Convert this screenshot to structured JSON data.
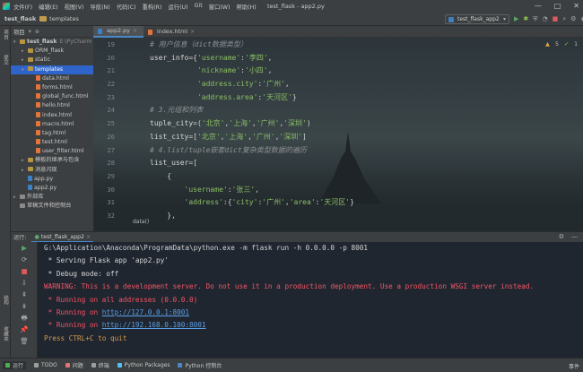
{
  "window": {
    "title": "test_flask - app2.py",
    "menu": [
      "文件(F)",
      "编辑(E)",
      "视图(V)",
      "导航(N)",
      "代码(C)",
      "重构(R)",
      "运行(U)",
      "Git",
      "窗口(W)",
      "帮助(H)"
    ],
    "controls": [
      "—",
      "□",
      "✕"
    ]
  },
  "navbar": {
    "project": "test_flask",
    "folder": "templates",
    "run_config": "test_flask_app2"
  },
  "left_stripe": [
    "项目",
    "提交",
    "结构",
    "收藏夹"
  ],
  "project_panel": {
    "title": "项目",
    "rows": [
      {
        "text": "test_flask",
        "hint": "E:\\PyCharm",
        "level": 0,
        "caret": "▾",
        "icon": "fold",
        "bold": true
      },
      {
        "text": "ORM_flask",
        "level": 1,
        "caret": "▸",
        "icon": "fold"
      },
      {
        "text": "static",
        "level": 1,
        "caret": "▸",
        "icon": "fold"
      },
      {
        "text": "templates",
        "level": 1,
        "caret": "▾",
        "icon": "fold",
        "selected": true
      },
      {
        "text": "data.html",
        "level": 2,
        "caret": "",
        "icon": "htm"
      },
      {
        "text": "forms.html",
        "level": 2,
        "caret": "",
        "icon": "htm"
      },
      {
        "text": "global_func.html",
        "level": 2,
        "caret": "",
        "icon": "htm"
      },
      {
        "text": "hello.html",
        "level": 2,
        "caret": "",
        "icon": "htm"
      },
      {
        "text": "index.html",
        "level": 2,
        "caret": "",
        "icon": "htm"
      },
      {
        "text": "macro.html",
        "level": 2,
        "caret": "",
        "icon": "htm"
      },
      {
        "text": "tag.html",
        "level": 2,
        "caret": "",
        "icon": "htm"
      },
      {
        "text": "test.html",
        "level": 2,
        "caret": "",
        "icon": "htm"
      },
      {
        "text": "user_filter.html",
        "level": 2,
        "caret": "",
        "icon": "htm"
      },
      {
        "text": "模板的继承与包含",
        "level": 1,
        "caret": "▸",
        "icon": "fold"
      },
      {
        "text": "消息闪现",
        "level": 1,
        "caret": "▸",
        "icon": "fold"
      },
      {
        "text": "app.py",
        "level": 1,
        "caret": "",
        "icon": "pyf"
      },
      {
        "text": "app2.py",
        "level": 1,
        "caret": "",
        "icon": "pyf"
      },
      {
        "text": "外部库",
        "level": 0,
        "caret": "▸",
        "icon": "lib"
      },
      {
        "text": "草稿文件和控制台",
        "level": 0,
        "caret": "",
        "icon": "lib"
      }
    ]
  },
  "editor": {
    "tabs": [
      {
        "label": "app2.py",
        "active": true
      },
      {
        "label": "index.html",
        "active": false
      }
    ],
    "warnings": "5",
    "weak": "1",
    "line_numbers": [
      "19",
      "20",
      "21",
      "22",
      "23",
      "24",
      "25",
      "26",
      "27",
      "28",
      "29",
      "30",
      "31",
      "32"
    ],
    "lines": [
      [
        {
          "t": "# 用户信息（dict数据类型）",
          "c": "c-c"
        }
      ],
      [
        {
          "t": "user_info",
          "c": "c-v"
        },
        {
          "t": "={",
          "c": "c-p"
        },
        {
          "t": "'username'",
          "c": "c-s"
        },
        {
          "t": ":",
          "c": "c-p"
        },
        {
          "t": "'李四'",
          "c": "c-s"
        },
        {
          "t": ",",
          "c": "c-p"
        }
      ],
      [
        {
          "t": "           ",
          "c": "c-p"
        },
        {
          "t": "'nickname'",
          "c": "c-s"
        },
        {
          "t": ":",
          "c": "c-p"
        },
        {
          "t": "'小四'",
          "c": "c-s"
        },
        {
          "t": ",",
          "c": "c-p"
        }
      ],
      [
        {
          "t": "           ",
          "c": "c-p"
        },
        {
          "t": "'address.city'",
          "c": "c-s"
        },
        {
          "t": ":",
          "c": "c-p"
        },
        {
          "t": "'广州'",
          "c": "c-s"
        },
        {
          "t": ",",
          "c": "c-p"
        }
      ],
      [
        {
          "t": "           ",
          "c": "c-p"
        },
        {
          "t": "'address.area'",
          "c": "c-s"
        },
        {
          "t": ":",
          "c": "c-p"
        },
        {
          "t": "'天河区'",
          "c": "c-s"
        },
        {
          "t": "}",
          "c": "c-p"
        }
      ],
      [
        {
          "t": "# 3.元组和列表",
          "c": "c-c"
        }
      ],
      [
        {
          "t": "tuple_city",
          "c": "c-v"
        },
        {
          "t": "=(",
          "c": "c-p"
        },
        {
          "t": "'北京'",
          "c": "c-s"
        },
        {
          "t": ",",
          "c": "c-p"
        },
        {
          "t": "'上海'",
          "c": "c-s"
        },
        {
          "t": ",",
          "c": "c-p"
        },
        {
          "t": "'广州'",
          "c": "c-s"
        },
        {
          "t": ",",
          "c": "c-p"
        },
        {
          "t": "'深圳'",
          "c": "c-s"
        },
        {
          "t": ")",
          "c": "c-p"
        }
      ],
      [
        {
          "t": "list_city",
          "c": "c-v"
        },
        {
          "t": "=[",
          "c": "c-p"
        },
        {
          "t": "'北京'",
          "c": "c-s"
        },
        {
          "t": ",",
          "c": "c-p"
        },
        {
          "t": "'上海'",
          "c": "c-s"
        },
        {
          "t": ",",
          "c": "c-p"
        },
        {
          "t": "'广州'",
          "c": "c-s"
        },
        {
          "t": ",",
          "c": "c-p"
        },
        {
          "t": "'深圳'",
          "c": "c-s"
        },
        {
          "t": "]",
          "c": "c-p"
        }
      ],
      [
        {
          "t": "# 4.list/tuple嵌套dict复杂类型数据的遍历",
          "c": "c-c"
        }
      ],
      [
        {
          "t": "list_user",
          "c": "c-v"
        },
        {
          "t": "=[",
          "c": "c-p"
        }
      ],
      [
        {
          "t": "    {",
          "c": "c-p"
        }
      ],
      [
        {
          "t": "        ",
          "c": "c-p"
        },
        {
          "t": "'username'",
          "c": "c-s"
        },
        {
          "t": ":",
          "c": "c-p"
        },
        {
          "t": "'张三'",
          "c": "c-s"
        },
        {
          "t": ",",
          "c": "c-p"
        }
      ],
      [
        {
          "t": "        ",
          "c": "c-p"
        },
        {
          "t": "'address'",
          "c": "c-s"
        },
        {
          "t": ":{",
          "c": "c-p"
        },
        {
          "t": "'city'",
          "c": "c-s"
        },
        {
          "t": ":",
          "c": "c-p"
        },
        {
          "t": "'广州'",
          "c": "c-s"
        },
        {
          "t": ",",
          "c": "c-p"
        },
        {
          "t": "'area'",
          "c": "c-s"
        },
        {
          "t": ":",
          "c": "c-p"
        },
        {
          "t": "'天河区'",
          "c": "c-s"
        },
        {
          "t": "}",
          "c": "c-p"
        }
      ],
      [
        {
          "t": "    },",
          "c": "c-p"
        }
      ]
    ],
    "breadcrumb": "data()"
  },
  "run_panel": {
    "label": "运行:",
    "tab": "test_flask_app2",
    "toolbar_icons": [
      "▶",
      "⟳",
      "■",
      "⇩",
      "⇞",
      "⇟",
      "🖶",
      "📌",
      "🗑"
    ],
    "console": [
      {
        "parts": [
          {
            "t": "G:\\Application\\Anaconda\\ProgramData\\python.exe -m flask run -h 0.0.0.0 -p 8001",
            "c": "o-n"
          }
        ]
      },
      {
        "parts": [
          {
            "t": " * Serving Flask app 'app2.py'",
            "c": "o-n"
          }
        ]
      },
      {
        "parts": [
          {
            "t": " * Debug mode: off",
            "c": "o-n"
          }
        ]
      },
      {
        "parts": [
          {
            "t": "WARNING: This is a development server. Do not use it in a production deployment. Use a production WSGI server instead.",
            "c": "o-r"
          }
        ]
      },
      {
        "parts": [
          {
            "t": " * Running on all addresses (0.0.0.0)",
            "c": "o-r"
          }
        ]
      },
      {
        "parts": [
          {
            "t": " * Running on ",
            "c": "o-r"
          },
          {
            "t": "http://127.0.0.1:8001",
            "c": "o-l"
          }
        ]
      },
      {
        "parts": [
          {
            "t": " * Running on ",
            "c": "o-r"
          },
          {
            "t": "http://192.168.0.100:8001",
            "c": "o-l"
          }
        ]
      },
      {
        "parts": [
          {
            "t": "Press CTRL+C to quit",
            "c": "o-y"
          }
        ]
      }
    ]
  },
  "bottom_bar": {
    "items": [
      {
        "label": "运行",
        "color": "#4caf50",
        "active": true
      },
      {
        "label": "TODO",
        "color": "#9e9e9e",
        "active": false
      },
      {
        "label": "问题",
        "color": "#e57373",
        "active": false
      },
      {
        "label": "终端",
        "color": "#9e9e9e",
        "active": false
      },
      {
        "label": "Python Packages",
        "color": "#4fc3f7",
        "active": false
      },
      {
        "label": "Python 控制台",
        "color": "#4a88c7",
        "active": false
      }
    ],
    "events": "事件"
  },
  "colors": {
    "accent": "#4a88c7",
    "selection": "#2f65ca",
    "string": "#8bbf64",
    "error": "#f75464",
    "link": "#5c9fe6"
  }
}
